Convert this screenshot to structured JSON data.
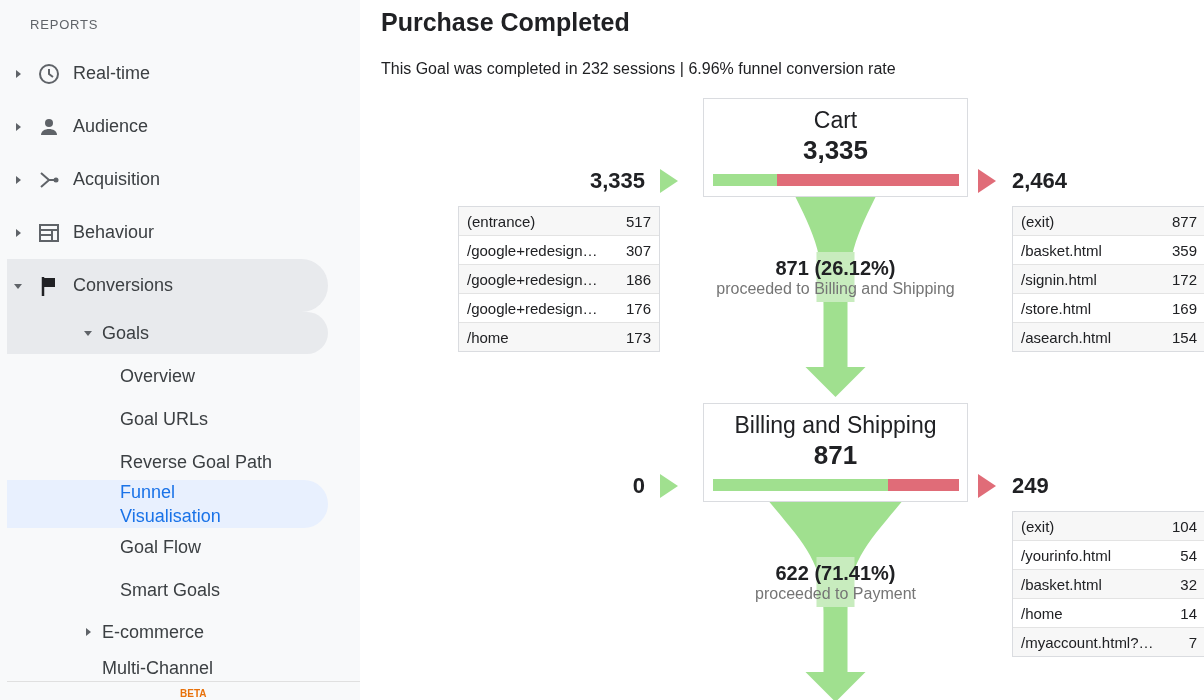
{
  "sidebar": {
    "heading": "REPORTS",
    "items": [
      {
        "label": "Real-time",
        "expanded": false
      },
      {
        "label": "Audience",
        "expanded": false
      },
      {
        "label": "Acquisition",
        "expanded": false
      },
      {
        "label": "Behaviour",
        "expanded": false
      },
      {
        "label": "Conversions",
        "expanded": true,
        "children": [
          {
            "label": "Goals",
            "expanded": true,
            "children": [
              {
                "label": "Overview",
                "selected": false
              },
              {
                "label": "Goal URLs",
                "selected": false
              },
              {
                "label": "Reverse Goal Path",
                "selected": false
              },
              {
                "label": "Funnel Visualisation",
                "selected": true
              },
              {
                "label": "Goal Flow",
                "selected": false
              },
              {
                "label": "Smart Goals",
                "selected": false
              }
            ]
          },
          {
            "label": "E-commerce",
            "expanded": false
          },
          {
            "label": "Multi-Channel"
          }
        ]
      }
    ],
    "badge": "BETA"
  },
  "title": "Purchase Completed",
  "summary": "This Goal was completed in 232 sessions | 6.96% funnel conversion rate",
  "stages": [
    {
      "name": "Cart",
      "count": "3,335",
      "level": 0.2612,
      "entries": "3,335",
      "exits": "2,464",
      "entry_rows": [
        {
          "page": "(entrance)",
          "count": "517"
        },
        {
          "page": "/google+redesign…",
          "count": "307"
        },
        {
          "page": "/google+redesign…",
          "count": "186"
        },
        {
          "page": "/google+redesign…",
          "count": "176"
        },
        {
          "page": "/home",
          "count": "173"
        }
      ],
      "exit_rows": [
        {
          "page": "(exit)",
          "count": "877"
        },
        {
          "page": "/basket.html",
          "count": "359"
        },
        {
          "page": "/signin.html",
          "count": "172"
        },
        {
          "page": "/store.html",
          "count": "169"
        },
        {
          "page": "/asearch.html",
          "count": "154"
        }
      ],
      "conversion": {
        "count": "871 (26.12%)",
        "label": "proceeded to Billing and Shipping"
      }
    },
    {
      "name": "Billing and Shipping",
      "count": "871",
      "level": 0.7141,
      "entries": "0",
      "exits": "249",
      "exit_rows": [
        {
          "page": "(exit)",
          "count": "104"
        },
        {
          "page": "/yourinfo.html",
          "count": "54"
        },
        {
          "page": "/basket.html",
          "count": "32"
        },
        {
          "page": "/home",
          "count": "14"
        },
        {
          "page": "/myaccount.html?…",
          "count": "7"
        }
      ],
      "conversion": {
        "count": "622 (71.41%)",
        "label": "proceeded to Payment"
      }
    }
  ]
}
